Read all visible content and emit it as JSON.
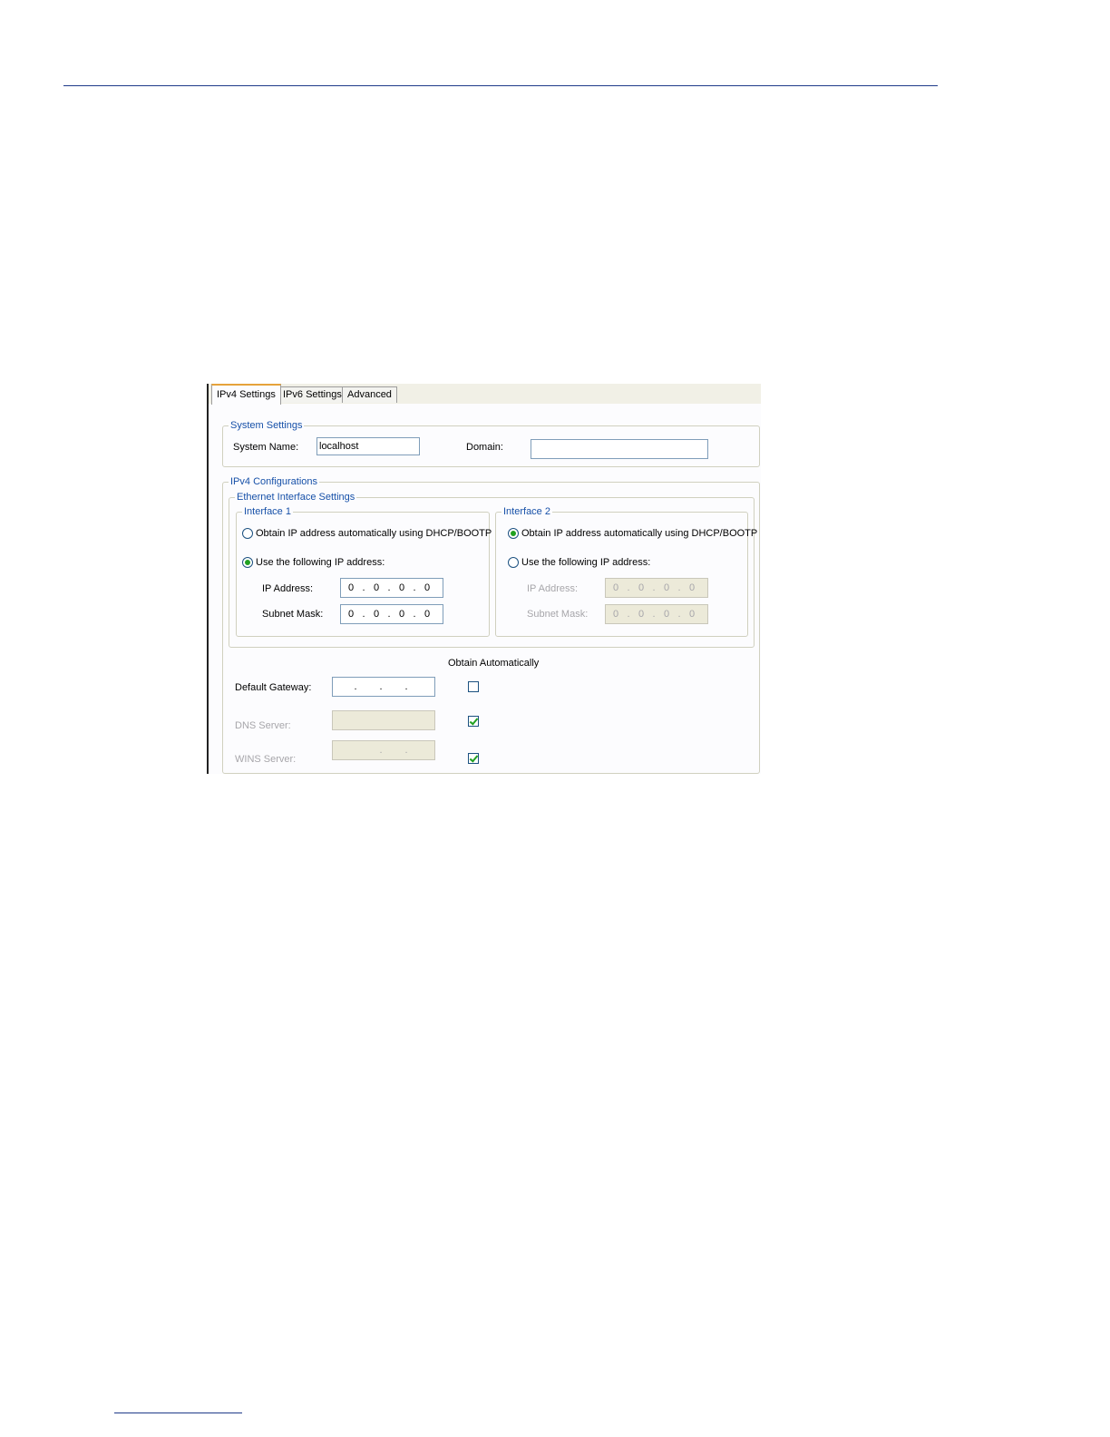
{
  "tabs": [
    {
      "label": "IPv4 Settings",
      "active": true
    },
    {
      "label": "IPv6 Settings",
      "active": false
    },
    {
      "label": "Advanced",
      "active": false
    }
  ],
  "system_settings": {
    "legend": "System Settings",
    "system_name_label": "System Name:",
    "system_name_value": "localhost",
    "domain_label": "Domain:",
    "domain_value": ""
  },
  "ipv4": {
    "legend": "IPv4 Configurations",
    "ethernet_legend": "Ethernet Interface Settings",
    "interface1": {
      "legend": "Interface 1",
      "dhcp_label": "Obtain IP address automatically using DHCP/BOOTP",
      "dhcp_selected": false,
      "static_label": "Use the following IP address:",
      "static_selected": true,
      "ip_label": "IP Address:",
      "ip_octets": [
        "0",
        "0",
        "0",
        "0"
      ],
      "mask_label": "Subnet Mask:",
      "mask_octets": [
        "0",
        "0",
        "0",
        "0"
      ]
    },
    "interface2": {
      "legend": "Interface 2",
      "dhcp_label": "Obtain IP address automatically using DHCP/BOOTP",
      "dhcp_selected": true,
      "static_label": "Use the following IP address:",
      "static_selected": false,
      "ip_label": "IP Address:",
      "ip_octets": [
        "0",
        "0",
        "0",
        "0"
      ],
      "mask_label": "Subnet Mask:",
      "mask_octets": [
        "0",
        "0",
        "0",
        "0"
      ]
    },
    "obtain_automatically_label": "Obtain Automatically",
    "default_gateway_label": "Default Gateway:",
    "default_gateway_auto": false,
    "dns_server_label": "DNS Server:",
    "dns_server_auto": true,
    "wins_server_label": "WINS Server:",
    "wins_server_auto": true
  },
  "colors": {
    "legend_text": "#1650a8",
    "active_tab_accent": "#e6a23a",
    "check_mark": "#21a121",
    "rule": "#1f3a8a"
  }
}
